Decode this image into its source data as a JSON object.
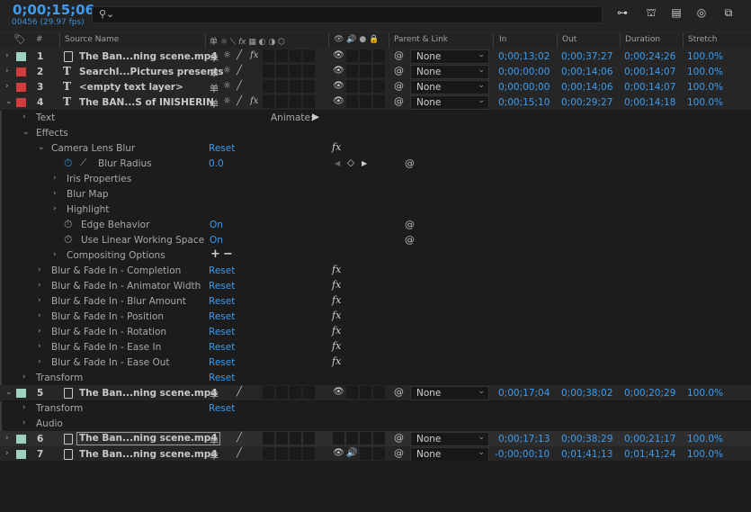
{
  "topbar": {
    "timecode": "0;00;15;06",
    "frames": "00456 (29.97 fps)",
    "icons": [
      "composition-flowchart-icon",
      "shy-layers-icon",
      "frame-blending-icon",
      "motion-blur-icon",
      "graph-editor-icon"
    ]
  },
  "columns": {
    "num": "#",
    "source_name": "Source Name",
    "parent_link": "Parent & Link",
    "in": "In",
    "out": "Out",
    "duration": "Duration",
    "stretch": "Stretch",
    "switches": "单 ☼ ⟍ fx"
  },
  "layers": [
    {
      "num": "1",
      "name": "The Ban...ning scene.mp4",
      "color": "#9fd1c0",
      "type": "footage",
      "parent": "None",
      "in": "0;00;13;02",
      "out": "0;00;37;27",
      "duration": "0;00;24;26",
      "stretch": "100.0%"
    },
    {
      "num": "2",
      "name": "SearchI...Pictures presents",
      "color": "#d23c3c",
      "type": "text",
      "parent": "None",
      "in": "0;00;00;00",
      "out": "0;00;14;06",
      "duration": "0;00;14;07",
      "stretch": "100.0%"
    },
    {
      "num": "3",
      "name": "<empty text layer>",
      "color": "#d23c3c",
      "type": "text",
      "parent": "None",
      "in": "0;00;00;00",
      "out": "0;00;14;06",
      "duration": "0;00;14;07",
      "stretch": "100.0%"
    },
    {
      "num": "4",
      "name": "The BAN...S of INISHERIN",
      "color": "#d23c3c",
      "type": "text",
      "parent": "None",
      "in": "0;00;15;10",
      "out": "0;00;29;27",
      "duration": "0;00;14;18",
      "stretch": "100.0%"
    },
    {
      "num": "5",
      "name": "The Ban...ning scene.mp4",
      "color": "#9fd1c0",
      "type": "footage",
      "parent": "None",
      "in": "0;00;17;04",
      "out": "0;00;38;02",
      "duration": "0;00;20;29",
      "stretch": "100.0%"
    },
    {
      "num": "6",
      "name": "The Ban...ning scene.mp4",
      "color": "#9fd1c0",
      "type": "footage",
      "parent": "None",
      "in": "0;00;17;13",
      "out": "0;00;38;29",
      "duration": "0;00;21;17",
      "stretch": "100.0%"
    },
    {
      "num": "7",
      "name": "The Ban...ning scene.mp4",
      "color": "#9fd1c0",
      "type": "footage",
      "parent": "None",
      "in": "-0;00;00;10",
      "out": "0;01;41;13",
      "duration": "0;01;41;24",
      "stretch": "100.0%"
    }
  ],
  "props": {
    "text": "Text",
    "animate": "Animate:",
    "effects": "Effects",
    "camera_lens_blur": "Camera Lens Blur",
    "reset": "Reset",
    "blur_radius": "Blur Radius",
    "blur_radius_value": "0.0",
    "iris_properties": "Iris Properties",
    "blur_map": "Blur Map",
    "highlight": "Highlight",
    "edge_behavior": "Edge Behavior",
    "edge_behavior_value": "On",
    "use_linear": "Use Linear Working Space",
    "use_linear_value": "On",
    "compositing_options": "Compositing Options",
    "effects_list": [
      "Blur & Fade In - Completion",
      "Blur & Fade In - Animator Width",
      "Blur & Fade In - Blur Amount",
      "Blur & Fade In - Position",
      "Blur & Fade In - Rotation",
      "Blur & Fade In - Ease In",
      "Blur & Fade In - Ease Out"
    ],
    "transform": "Transform",
    "audio": "Audio"
  }
}
